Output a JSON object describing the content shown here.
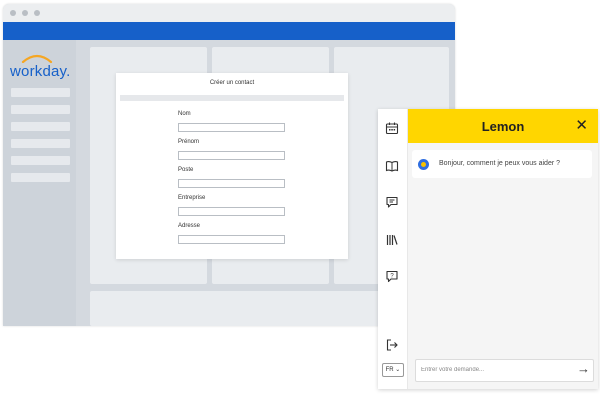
{
  "app": {
    "brand": "workday."
  },
  "modal": {
    "title": "Créer un contact",
    "fields": [
      {
        "label": "Nom",
        "value": ""
      },
      {
        "label": "Prénom",
        "value": ""
      },
      {
        "label": "Poste",
        "value": ""
      },
      {
        "label": "Entreprise",
        "value": ""
      },
      {
        "label": "Adresse",
        "value": ""
      }
    ]
  },
  "assistant": {
    "title": "Lemon",
    "close_glyph": "✕",
    "greeting": "Bonjour, comment je peux vous aider ?",
    "input_placeholder": "Entrer votre demande...",
    "send_glyph": "→",
    "language": "FR ⌄",
    "rail_icons": [
      "calendar-icon",
      "book-icon",
      "chat-icon",
      "library-icon",
      "help-icon",
      "logout-icon"
    ]
  },
  "colors": {
    "brand_blue": "#1660c9",
    "accent_yellow": "#ffd600"
  }
}
